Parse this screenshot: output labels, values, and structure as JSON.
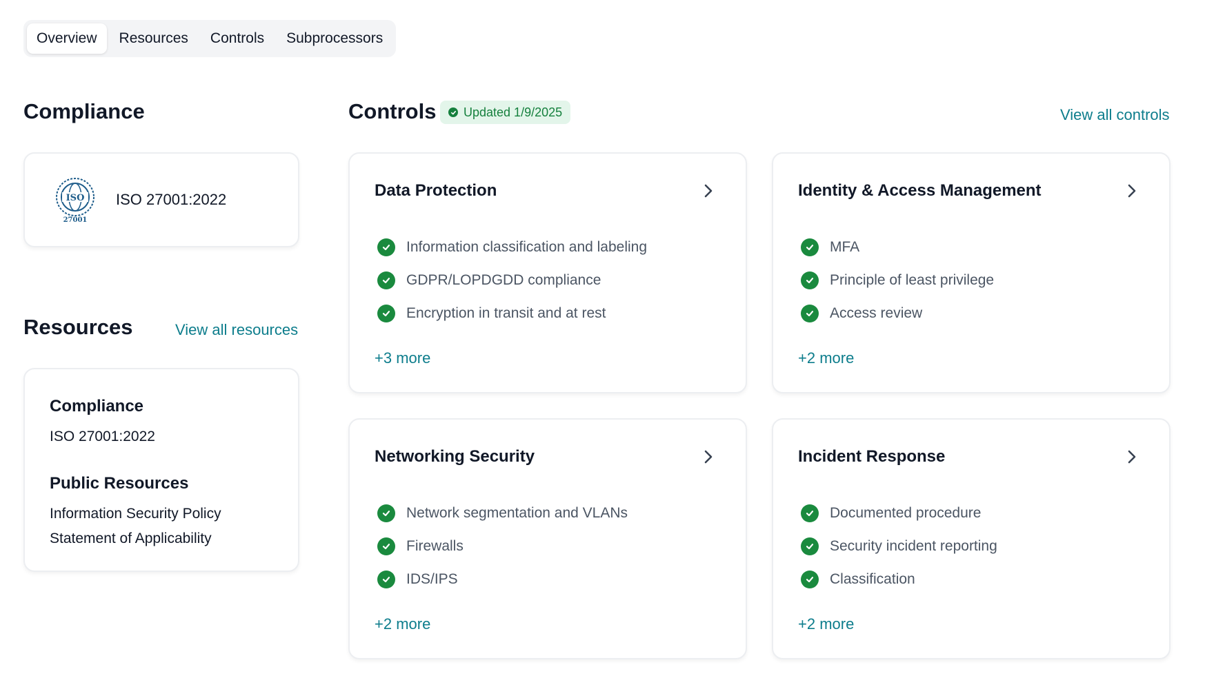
{
  "tabs": [
    {
      "label": "Overview",
      "active": true
    },
    {
      "label": "Resources",
      "active": false
    },
    {
      "label": "Controls",
      "active": false
    },
    {
      "label": "Subprocessors",
      "active": false
    }
  ],
  "compliance": {
    "title": "Compliance",
    "items": [
      {
        "name": "ISO 27001:2022",
        "logo": "ISO 27001 certification seal"
      }
    ]
  },
  "resources": {
    "title": "Resources",
    "view_all": "View all resources",
    "card": {
      "compliance_heading": "Compliance",
      "compliance_item": "ISO 27001:2022",
      "public_heading": "Public Resources",
      "public_items": [
        "Information Security Policy",
        "Statement of Applicability"
      ]
    }
  },
  "controls": {
    "title": "Controls",
    "badge": "Updated 1/9/2025",
    "view_all": "View all controls",
    "cards": [
      {
        "title": "Data Protection",
        "items": [
          "Information classification and labeling",
          "GDPR/LOPDGDD compliance",
          "Encryption in transit and at rest"
        ],
        "more": "+3 more"
      },
      {
        "title": "Identity & Access Management",
        "items": [
          "MFA",
          "Principle of least privilege",
          "Access review"
        ],
        "more": "+2 more"
      },
      {
        "title": "Networking Security",
        "items": [
          "Network segmentation and VLANs",
          "Firewalls",
          "IDS/IPS"
        ],
        "more": "+2 more"
      },
      {
        "title": "Incident Response",
        "items": [
          "Documented procedure",
          "Security incident reporting",
          "Classification"
        ],
        "more": "+2 more"
      }
    ]
  },
  "colors": {
    "accent": "#0d7d8c",
    "success": "#1a8a3e",
    "badge_bg": "#e3f5ea"
  }
}
